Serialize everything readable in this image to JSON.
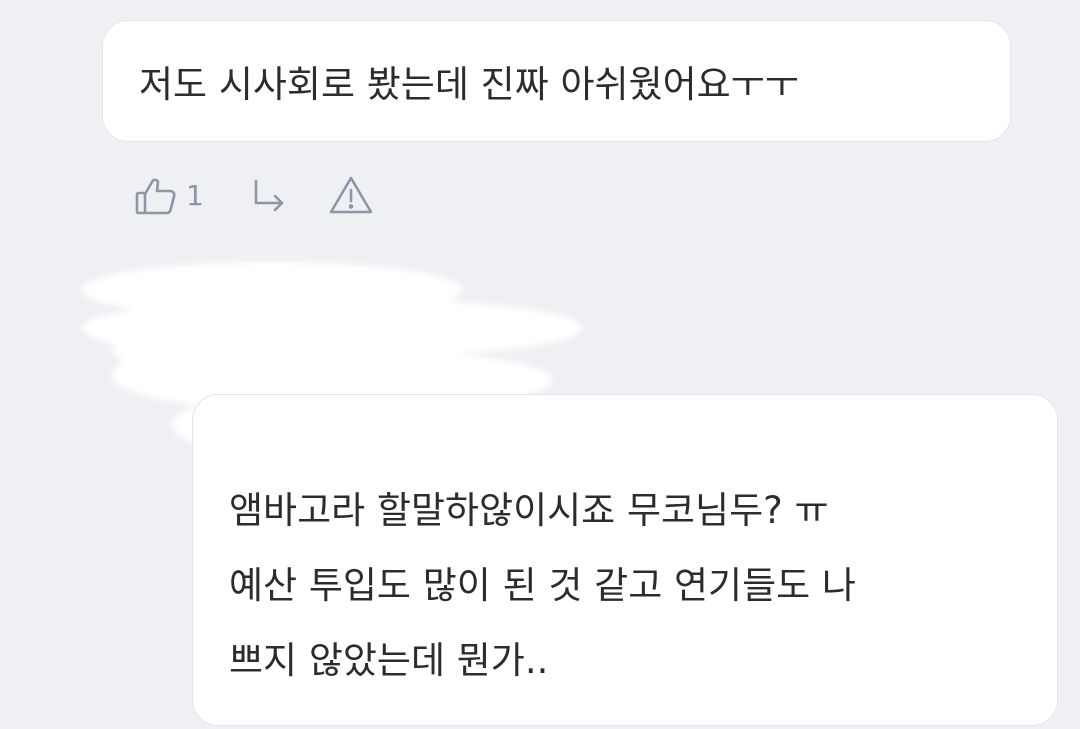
{
  "comment": {
    "text": "저도 시사회로 봤는데 진짜 아쉬웠어요ㅜㅜ",
    "like_count": "1"
  },
  "actions": {
    "like_icon": "thumbs-up-icon",
    "reply_icon": "reply-arrow-icon",
    "report_icon": "warning-triangle-icon"
  },
  "reply": {
    "lines": [
      "앰바고라 할말하않이시죠 무코님두? ㅠ",
      "예산 투입도 많이 된 것 같고 연기들도 나",
      "쁘지 않았는데 뭔가.."
    ]
  },
  "colors": {
    "background": "#eff0f3",
    "bubble": "#ffffff",
    "text": "#2b2c30",
    "icon": "#8e95a5"
  }
}
